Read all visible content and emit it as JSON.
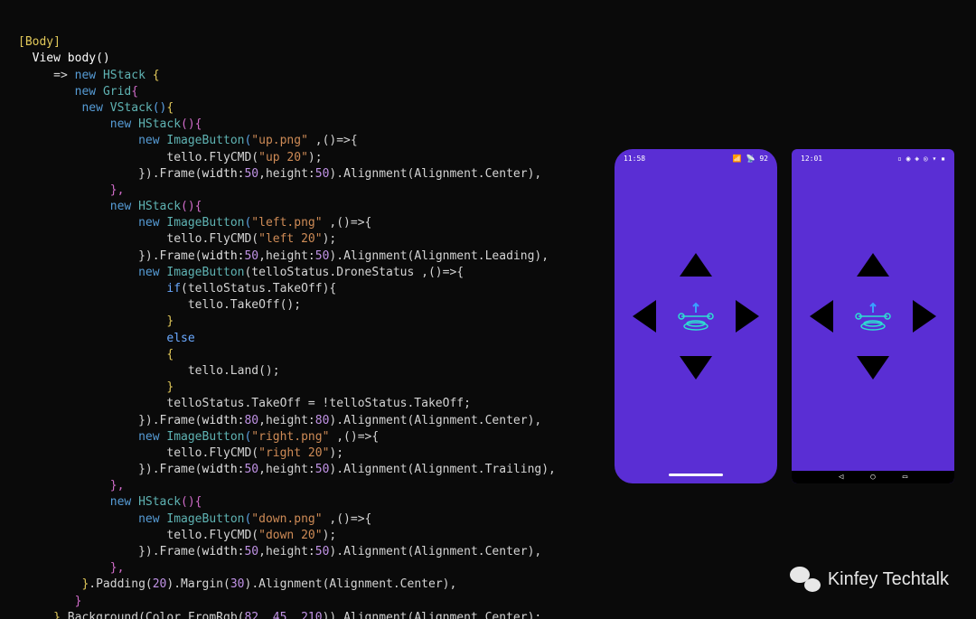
{
  "code": {
    "attr_body": "[Body]",
    "view_sig": "View body()",
    "lambda": "=> ",
    "new_kw": "new",
    "hstack": "HStack",
    "grid": "Grid",
    "vstack": "VStack",
    "imgbtn": "ImageButton",
    "if_kw": "if",
    "else_kw": "else",
    "frame": "Frame",
    "padding": "Padding",
    "margin": "Margin",
    "alignment": "Alignment",
    "background": "Background",
    "bg_args": "(Color.FromRgb(",
    "bg_end": ")).Alignment(Alignment.Center);",
    "tello_takeoff": "tello.TakeOff();",
    "tello_land": "tello.Land();",
    "toggle": "telloStatus.TakeOff = !telloStatus.TakeOff;",
    "status_cond": "(telloStatus.TakeOff){",
    "drone_status_arg": "(telloStatus.DroneStatus ,()=>{",
    "width_lbl": "width:",
    "height_lbl": ",height:",
    "align_center": ").Alignment(Alignment.Center),",
    "align_leading": ").Alignment(Alignment.Leading),",
    "align_trailing": ").Alignment(Alignment.Trailing),",
    "pad_margin_tail": ").Alignment(Alignment.Center),",
    "up_png": "\"up.png\"",
    "left_png": "\"left.png\"",
    "right_png": "\"right.png\"",
    "down_png": "\"down.png\"",
    "cmd_up": "\"up 20\"",
    "cmd_left": "\"left 20\"",
    "cmd_right": "\"right 20\"",
    "cmd_down": "\"down 20\"",
    "flycmd_pre": "tello.FlyCMD(",
    "flycmd_post": ");",
    "lambda_arrow": " ,()=>{",
    "close_frame_pre": "}).Frame(",
    "open_brace": " {",
    "close_paren_open_brace": "(){",
    "close_brace_comma": "},",
    "close_brace": "}",
    "num_50": "50",
    "num_80": "80",
    "num_20": "20",
    "num_30": "30",
    "bg_r": "82",
    "bg_g": "45",
    "bg_b": "210",
    "dot_margin": ").Margin("
  },
  "phones": {
    "ios_time": "11:58",
    "ios_batt": "92",
    "android_time": "12:01"
  },
  "watermark": "Kinfey Techtalk"
}
